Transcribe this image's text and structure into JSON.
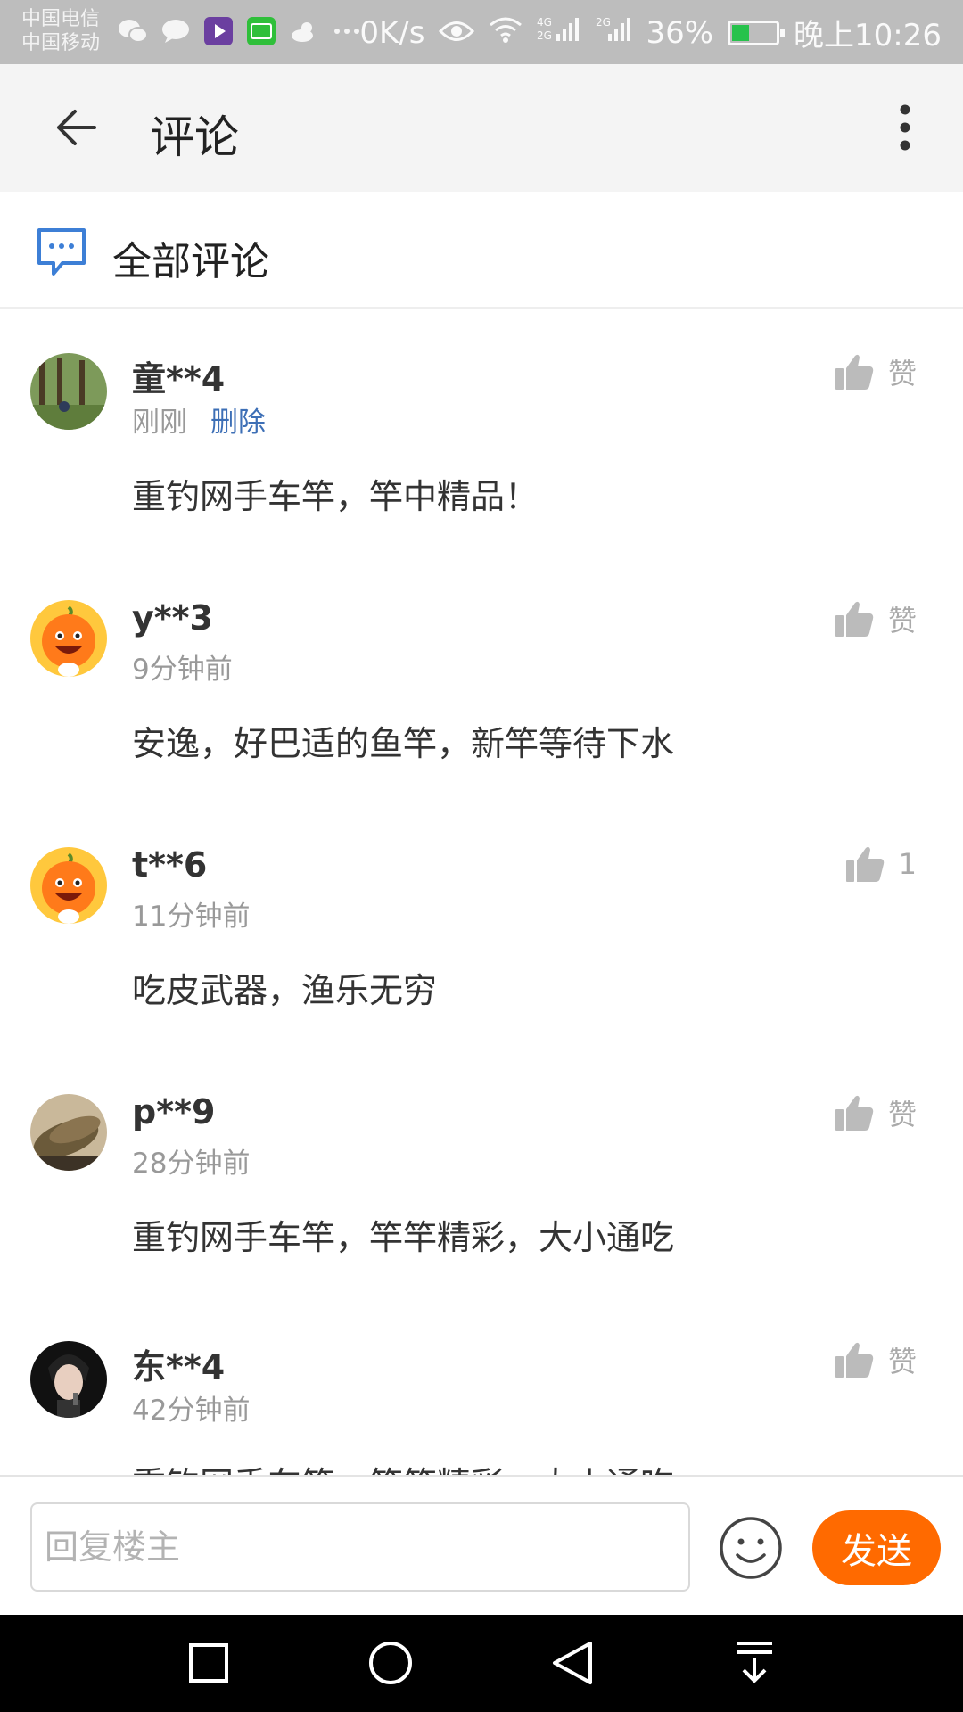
{
  "status_bar": {
    "carrier_1": "中国电信",
    "carrier_2": "中国移动",
    "speed": "0K/s",
    "battery": "36%",
    "time": "晚上10:26"
  },
  "app_bar": {
    "title": "评论"
  },
  "section": {
    "title": "全部评论"
  },
  "comments": [
    {
      "user": "童**4",
      "time": "刚刚",
      "delete": "删除",
      "text": "重钓网手车竿，竿中精品！",
      "like": "赞"
    },
    {
      "user": "y**3",
      "time": "9分钟前",
      "text": "安逸，好巴适的鱼竿，新竿等待下水",
      "like": "赞"
    },
    {
      "user": "t**6",
      "time": "11分钟前",
      "text": "吃皮武器，渔乐无穷",
      "like": "1"
    },
    {
      "user": "p**9",
      "time": "28分钟前",
      "text": "重钓网手车竿，竿竿精彩，大小通吃",
      "like": "赞"
    },
    {
      "user": "东**4",
      "time": "42分钟前",
      "text": "重钓网手车竿，竿竿精彩，大小通吃",
      "like": "赞"
    }
  ],
  "reply": {
    "placeholder": "回复楼主",
    "send_label": "发送"
  },
  "colors": {
    "accent": "#ff6a00",
    "link": "#3d6fb6",
    "header_bg": "#f4f4f4"
  }
}
